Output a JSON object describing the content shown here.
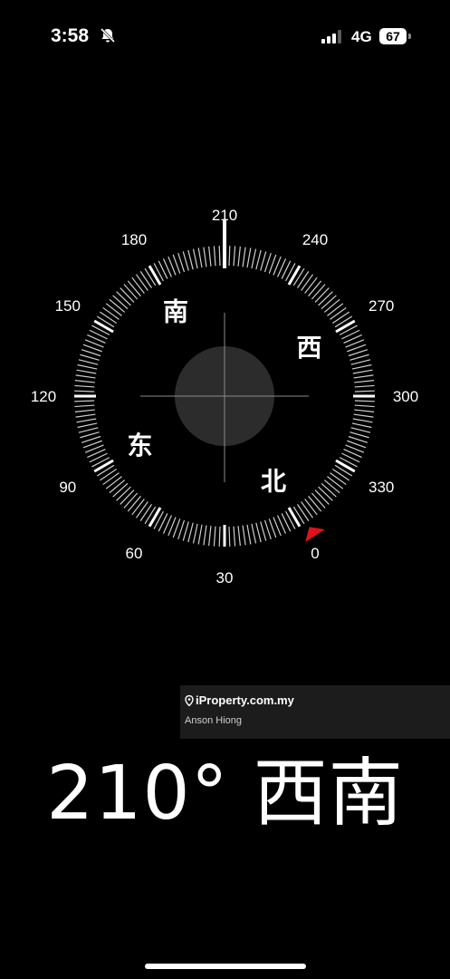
{
  "status_bar": {
    "time": "3:58",
    "network": "4G",
    "battery": "67"
  },
  "compass": {
    "heading_degrees": 210,
    "degree_labels": [
      "0",
      "30",
      "60",
      "90",
      "120",
      "150",
      "180",
      "210",
      "240",
      "270",
      "300",
      "330"
    ],
    "cardinals": {
      "north": "北",
      "east": "东",
      "south": "南",
      "west": "西"
    },
    "marker_color": "#e0121b"
  },
  "watermark": {
    "brand": "iProperty.com.my",
    "agent": "Anson Hiong"
  },
  "readout": {
    "text": "210° 西南"
  }
}
